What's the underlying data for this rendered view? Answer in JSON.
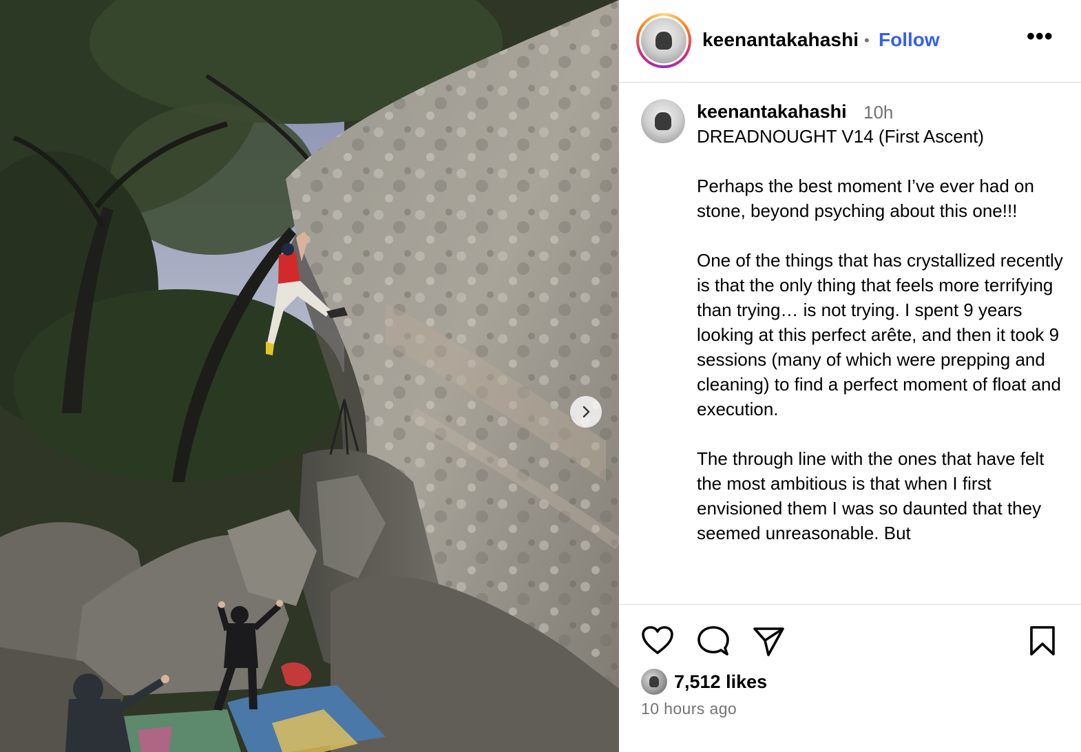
{
  "photo": {
    "alt_description_hidden": "",
    "next_icon": "chevron-right-icon"
  },
  "header": {
    "username": "keenantakahashi",
    "separator": "•",
    "follow_label": "Follow",
    "more_label": "•••",
    "avatar_icon": "profile-avatar"
  },
  "caption": {
    "username": "keenantakahashi",
    "time": "10h",
    "paragraphs": [
      "DREADNOUGHT V14 (First Ascent)",
      "Perhaps the best moment I’ve ever had on stone, beyond psyching about this one!!!",
      "One of the things that has crystallized recently is that the only thing that feels more terrifying than trying… is not trying. I spent 9 years looking at this perfect arête, and then it took 9 sessions (many of which were prepping and cleaning) to find a perfect moment of float and execution.",
      "The through line with the ones that have felt the most ambitious is that when I first envisioned them I was so daunted that they seemed unreasonable. But"
    ]
  },
  "actions": {
    "like_icon": "heart-icon",
    "comment_icon": "comment-icon",
    "share_icon": "share-icon",
    "save_icon": "bookmark-icon",
    "likes": "7,512 likes",
    "posted": "10 hours ago"
  },
  "colors": {
    "follow": "#3460f0",
    "muted": "#737373",
    "divider": "#dbdbdb"
  }
}
